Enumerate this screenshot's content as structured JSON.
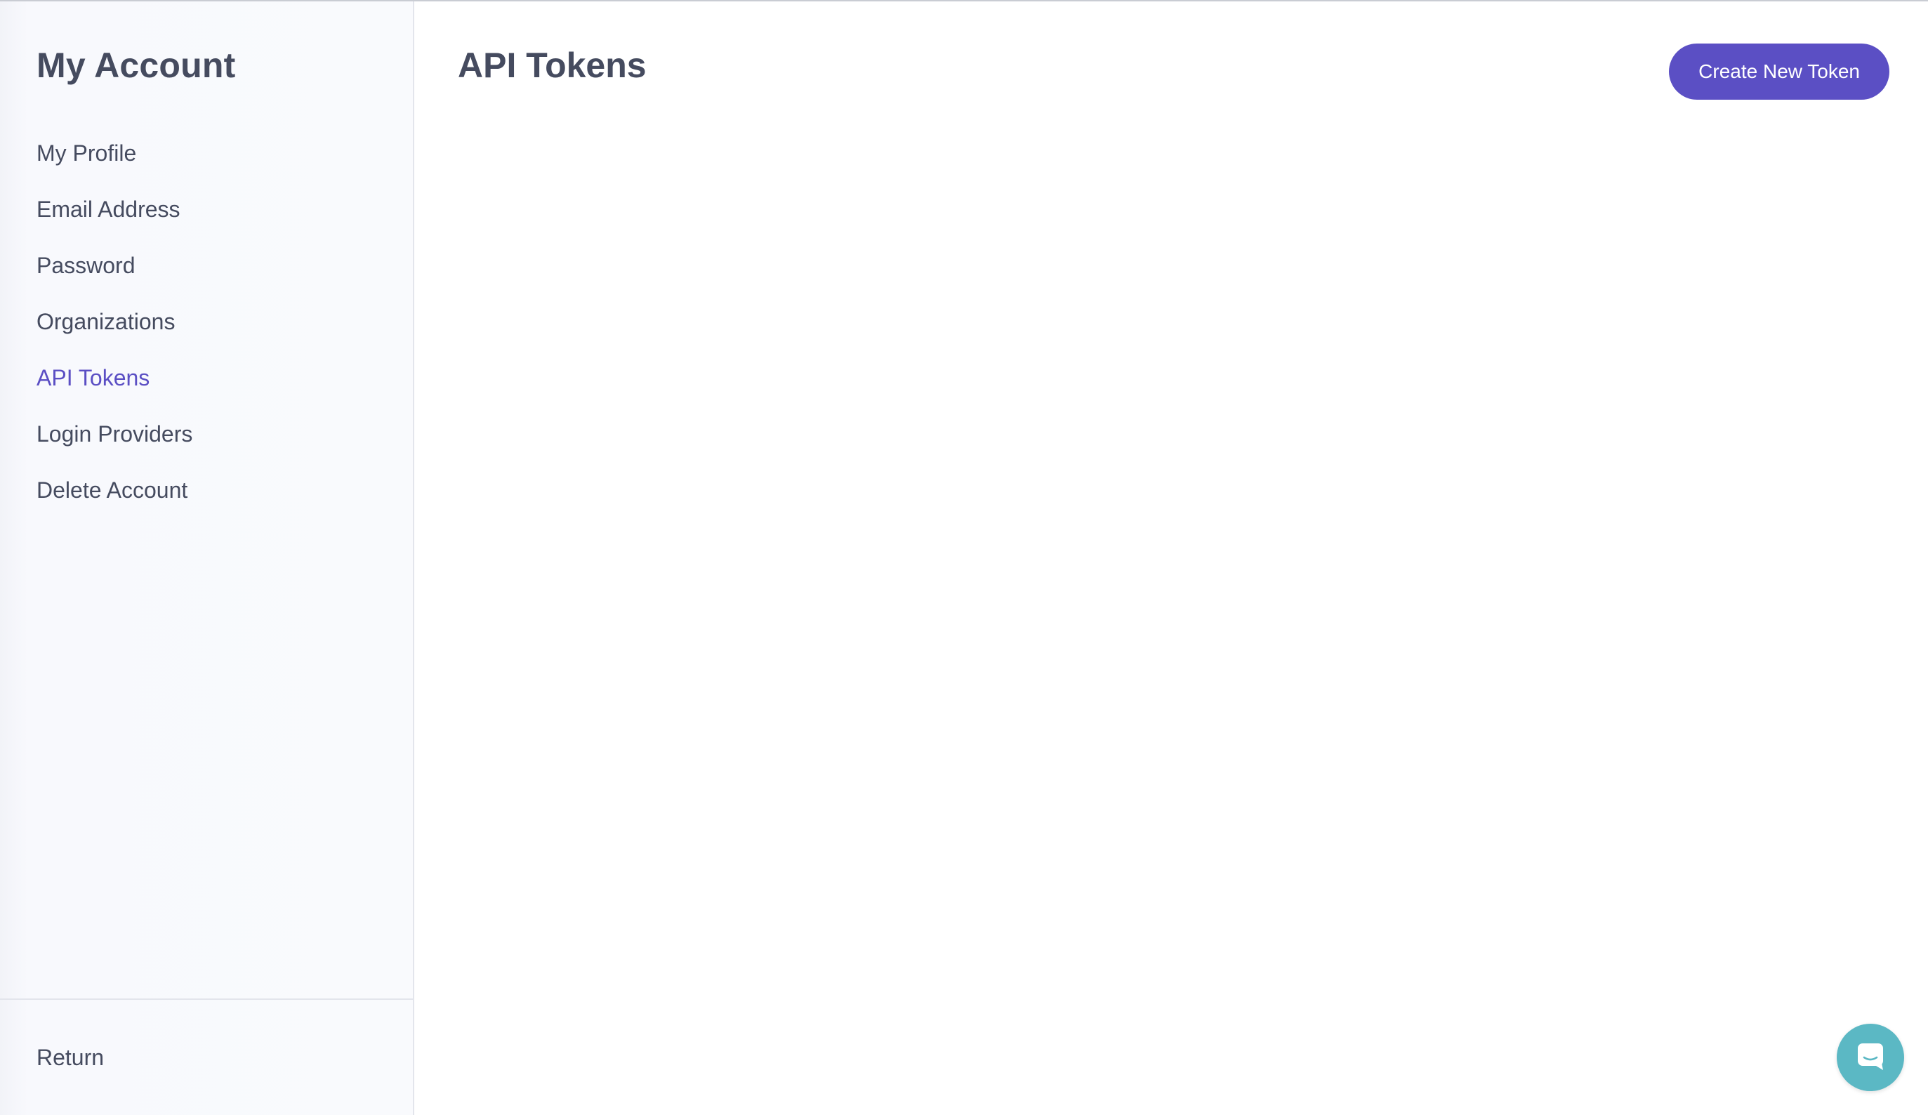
{
  "sidebar": {
    "title": "My Account",
    "items": [
      {
        "label": "My Profile"
      },
      {
        "label": "Email Address"
      },
      {
        "label": "Password"
      },
      {
        "label": "Organizations"
      },
      {
        "label": "API Tokens",
        "active": true
      },
      {
        "label": "Login Providers"
      },
      {
        "label": "Delete Account"
      }
    ],
    "footer": {
      "return_label": "Return"
    }
  },
  "main": {
    "title": "API Tokens",
    "create_button_label": "Create New Token"
  },
  "chat": {
    "icon": "chat-bubble-icon"
  },
  "colors": {
    "accent": "#5b4fc4",
    "text": "#454b5f",
    "sidebar_bg": "#f9fafd",
    "chat_launcher": "#5bb8c4"
  }
}
